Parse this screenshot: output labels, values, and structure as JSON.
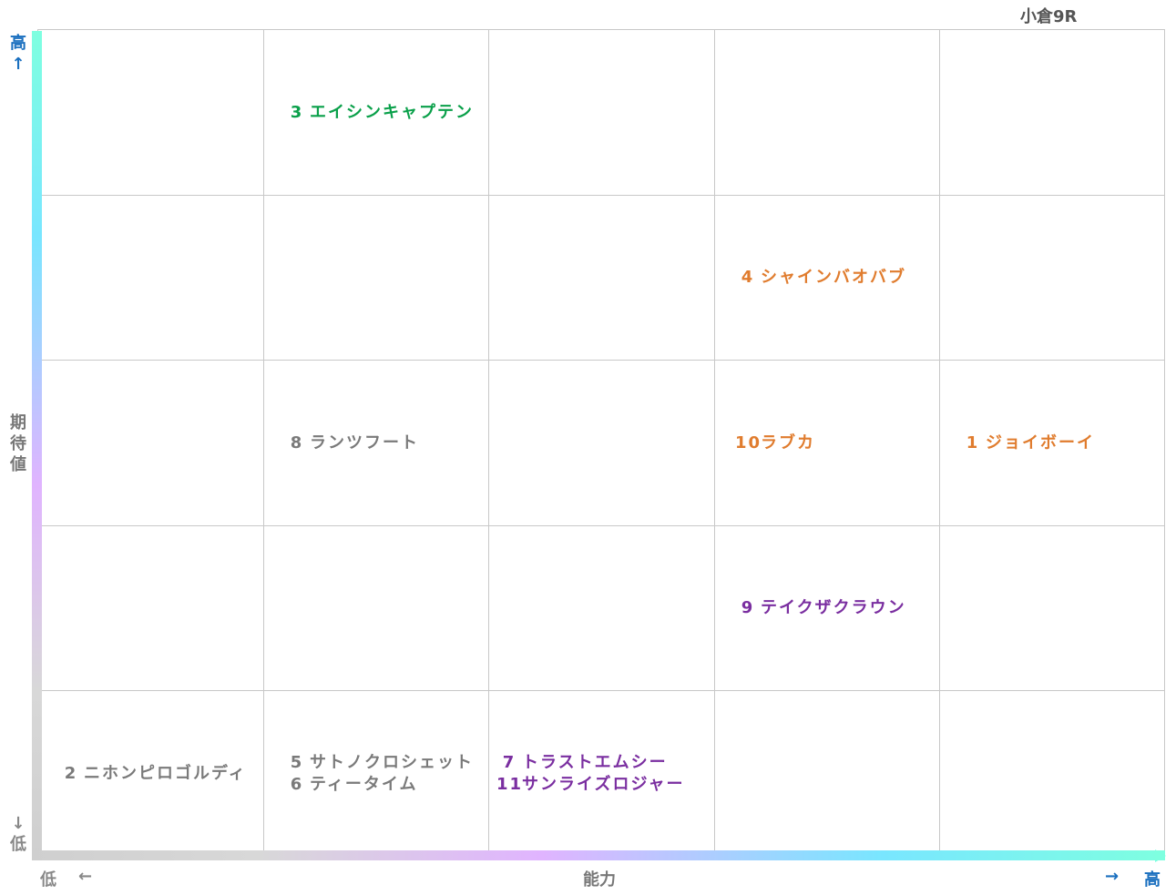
{
  "title": "小倉9R",
  "y_axis": {
    "high": "高",
    "up_arrow": "↑",
    "label": "期待値",
    "down_arrow": "↓",
    "low": "低"
  },
  "x_axis": {
    "low": "低",
    "left_arrow": "←",
    "label": "能力",
    "right_arrow": "→",
    "high": "高"
  },
  "colors": {
    "green": "#0aa04a",
    "orange": "#e07c2e",
    "gray": "#7a7a7a",
    "purple": "#7a2ea0",
    "high_label": "#1a6fbf"
  },
  "cells": {
    "r1c2": [
      {
        "num": "3",
        "name": "エイシンキャプテン",
        "color": "green"
      }
    ],
    "r2c4": [
      {
        "num": "4",
        "name": "シャインバオバブ",
        "color": "orange"
      }
    ],
    "r3c2": [
      {
        "num": "8",
        "name": "ランツフート",
        "color": "gray"
      }
    ],
    "r3c4": [
      {
        "num": "10",
        "name": "ラブカ",
        "color": "orange"
      }
    ],
    "r3c5": [
      {
        "num": "1",
        "name": "ジョイボーイ",
        "color": "orange"
      }
    ],
    "r4c4": [
      {
        "num": "9",
        "name": "テイクザクラウン",
        "color": "purple"
      }
    ],
    "r5c1": [
      {
        "num": "2",
        "name": "ニホンピロゴルディ",
        "color": "gray"
      }
    ],
    "r5c2": [
      {
        "num": "5",
        "name": "サトノクロシェット",
        "color": "gray"
      },
      {
        "num": "6",
        "name": "ティータイム",
        "color": "gray"
      }
    ],
    "r5c3": [
      {
        "num": "7",
        "name": "トラストエムシー",
        "color": "purple"
      },
      {
        "num": "11",
        "name": "サンライズロジャー",
        "color": "purple"
      }
    ]
  }
}
